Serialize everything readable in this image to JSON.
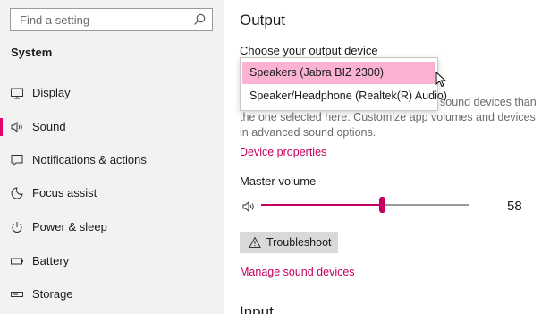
{
  "sidebar": {
    "search_placeholder": "Find a setting",
    "section_title": "System",
    "items": [
      {
        "label": "Display",
        "icon": "monitor-icon",
        "active": false
      },
      {
        "label": "Sound",
        "icon": "speaker-icon",
        "active": true
      },
      {
        "label": "Notifications & actions",
        "icon": "notifications-icon",
        "active": false
      },
      {
        "label": "Focus assist",
        "icon": "moon-icon",
        "active": false
      },
      {
        "label": "Power & sleep",
        "icon": "power-icon",
        "active": false
      },
      {
        "label": "Battery",
        "icon": "battery-icon",
        "active": false
      },
      {
        "label": "Storage",
        "icon": "storage-icon",
        "active": false
      }
    ]
  },
  "main": {
    "title": "Output",
    "output_device_label": "Choose your output device",
    "description": "sound devices than the one selected here. Customize app volumes and devices in advanced sound options.",
    "device_properties_link": "Device properties",
    "master_volume_label": "Master volume",
    "volume_value": "58",
    "volume_level": 0.58,
    "troubleshoot_label": "Troubleshoot",
    "manage_devices_link": "Manage sound devices",
    "next_heading": "Input"
  },
  "dropdown": {
    "options": [
      "Speakers (Jabra BIZ 2300)",
      "Speaker/Headphone (Realtek(R) Audio)"
    ],
    "selected_index": 0
  },
  "colors": {
    "accent": "#c3005f",
    "active_bar": "#e3006d",
    "selected_option": "#fcb3d3",
    "sidebar_bg": "#f2f2f2"
  }
}
